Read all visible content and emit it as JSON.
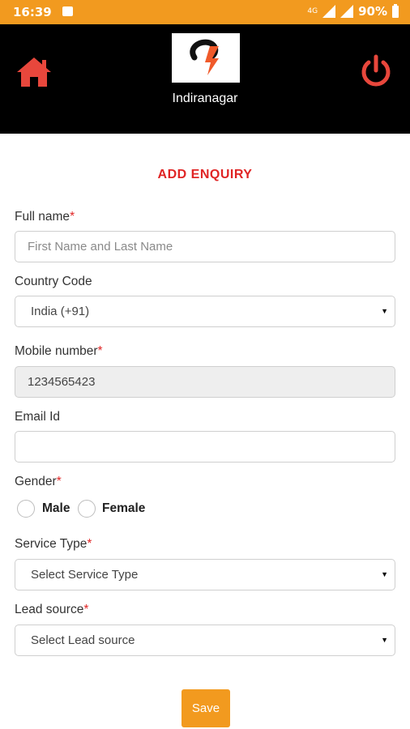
{
  "status_bar": {
    "time": "16:39",
    "network": "4G",
    "battery": "90%"
  },
  "header": {
    "branch": "Indiranagar",
    "icons": [
      "home-icon",
      "power-icon"
    ]
  },
  "colors": {
    "accent": "#f29a1f",
    "required": "#e02525",
    "header_bg": "#000000"
  },
  "form": {
    "title": "ADD ENQUIRY",
    "required_mark": "*",
    "full_name": {
      "label": "Full name",
      "placeholder": "First Name and Last Name"
    },
    "country_code": {
      "label": "Country Code",
      "value": "India (+91)"
    },
    "mobile": {
      "label": "Mobile number",
      "value": "1234565423"
    },
    "email": {
      "label": "Email Id",
      "value": ""
    },
    "gender": {
      "label": "Gender",
      "options": [
        "Male",
        "Female"
      ]
    },
    "service_type": {
      "label": "Service Type",
      "value": "Select Service Type"
    },
    "lead_source": {
      "label": "Lead source",
      "value": "Select Lead source"
    },
    "save_label": "Save"
  }
}
